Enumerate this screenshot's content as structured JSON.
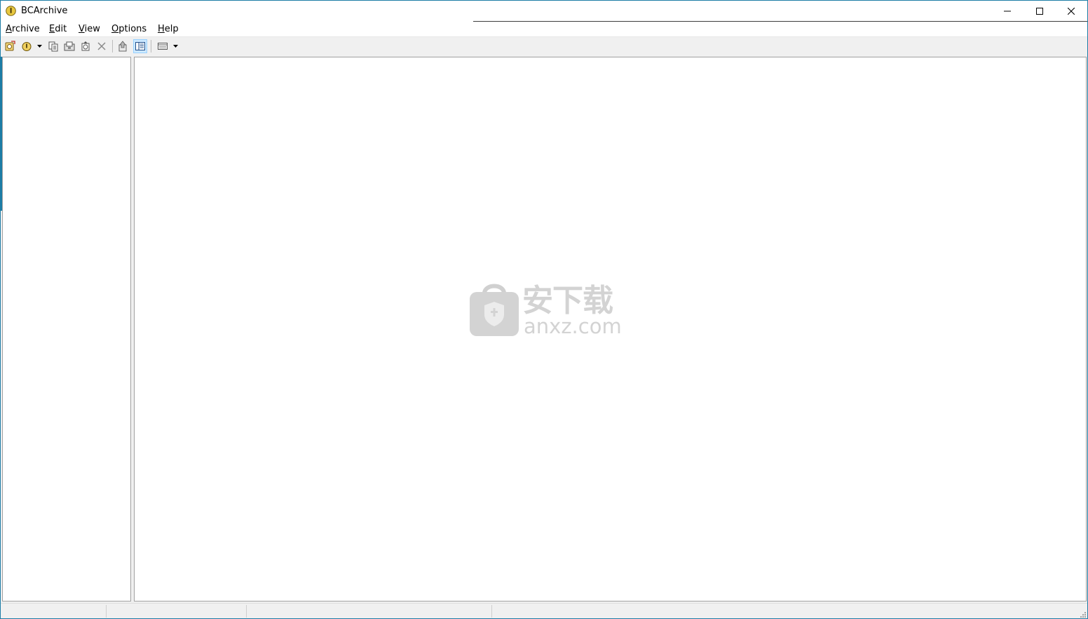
{
  "window": {
    "title": "BCArchive",
    "icon": "bcarchive-app-icon"
  },
  "title_buttons": {
    "minimize": "minimize-icon",
    "maximize": "maximize-icon",
    "close": "close-icon"
  },
  "menu": [
    {
      "label": "Archive",
      "accel": "A",
      "rest": "rchive"
    },
    {
      "label": "Edit",
      "accel": "E",
      "rest": "dit"
    },
    {
      "label": "View",
      "accel": "V",
      "rest": "iew"
    },
    {
      "label": "Options",
      "accel": "O",
      "rest": "ptions"
    },
    {
      "label": "Help",
      "accel": "H",
      "rest": "elp"
    }
  ],
  "toolbar": [
    {
      "icon": "new-archive-icon"
    },
    {
      "icon": "open-archive-icon",
      "dropdown": true
    },
    {
      "icon": "copy-icon"
    },
    {
      "icon": "extract-icon"
    },
    {
      "icon": "add-files-icon"
    },
    {
      "icon": "delete-icon"
    },
    {
      "icon": "up-folder-icon"
    },
    {
      "icon": "folder-tree-icon",
      "active": true
    },
    {
      "icon": "view-mode-icon",
      "dropdown": true
    }
  ],
  "watermark": {
    "cn_text": "安下载",
    "en_text": "anxz.com"
  },
  "statusbar": {
    "cells": [
      "",
      "",
      ""
    ]
  }
}
